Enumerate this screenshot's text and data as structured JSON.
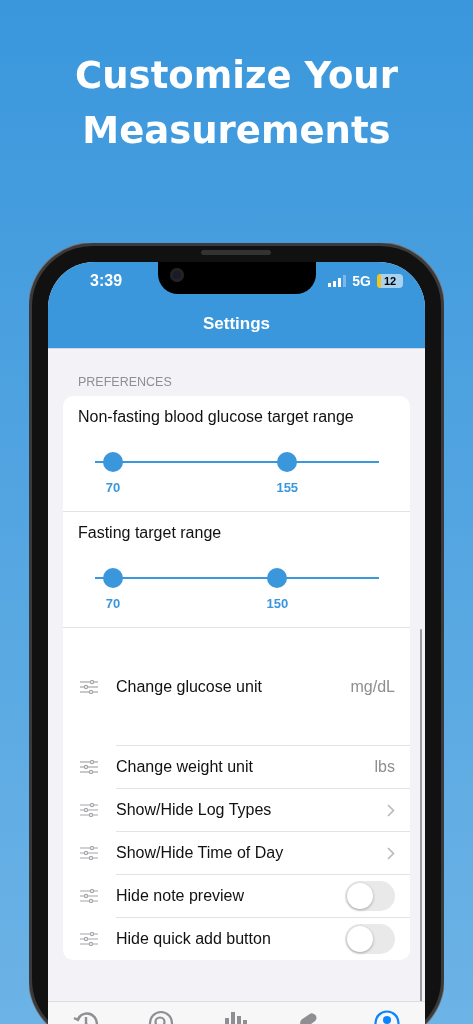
{
  "headline": "Customize Your Measurements",
  "status_bar": {
    "time": "3:39",
    "network": "5G",
    "battery": "12"
  },
  "nav": {
    "title": "Settings"
  },
  "section": {
    "title": "PREFERENCES"
  },
  "ranges": [
    {
      "label": "Non-fasting blood glucose target range",
      "thumbs": [
        {
          "level": 0.063,
          "reading": "70"
        },
        {
          "level": 0.677,
          "reading": "155"
        }
      ]
    },
    {
      "label": "Fasting target range",
      "thumbs": [
        {
          "level": 0.063,
          "reading": "70"
        },
        {
          "level": 0.642,
          "reading": "150"
        }
      ]
    }
  ],
  "rows": [
    {
      "kind": "value",
      "label": "Change glucose unit",
      "value": "mg/dL"
    },
    {
      "kind": "value",
      "label": "Change weight unit",
      "value": "lbs"
    },
    {
      "kind": "chevron",
      "label": "Show/Hide Log Types"
    },
    {
      "kind": "chevron",
      "label": "Show/Hide Time of Day"
    },
    {
      "kind": "toggle",
      "label": "Hide note preview",
      "on": false
    },
    {
      "kind": "toggle",
      "label": "Hide quick add button",
      "on": false
    }
  ],
  "tab_bar": {
    "tabs": [
      {
        "kind": "history",
        "selected": false
      },
      {
        "kind": "search",
        "selected": false
      },
      {
        "kind": "chart",
        "selected": false
      },
      {
        "kind": "pills",
        "selected": false
      },
      {
        "kind": "profile",
        "selected": true
      }
    ]
  }
}
